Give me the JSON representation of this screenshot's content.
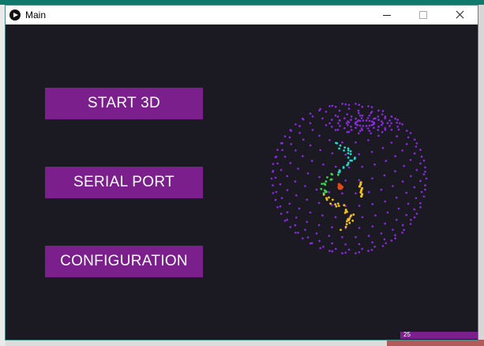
{
  "window": {
    "title": "Main"
  },
  "menu": {
    "start_3d": "START 3D",
    "serial_port": "SERIAL PORT",
    "configuration": "CONFIGURATION"
  },
  "progress": {
    "value_text": "25",
    "fraction": 1.0
  },
  "colors": {
    "button": "#7b1f8c",
    "canvas_background": "#1b1a22",
    "sphere_points": "#8b2be0",
    "highlight_points": [
      "#27d6c8",
      "#3ad34a",
      "#f5c21a",
      "#e04a1a"
    ]
  },
  "icons": {
    "app": "play-circle-icon",
    "minimize": "minimize-icon",
    "maximize": "maximize-icon",
    "close": "close-icon"
  }
}
